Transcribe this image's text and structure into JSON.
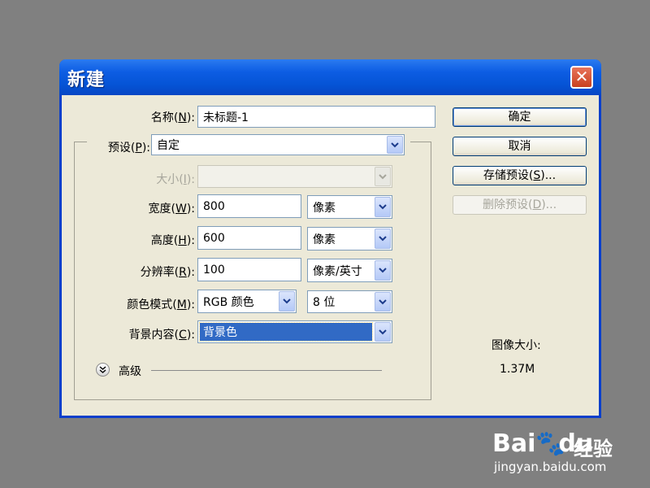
{
  "dialog": {
    "title": "新建",
    "close_glyph": "✕"
  },
  "form": {
    "name_label": "名称(",
    "name_key": "N",
    "name_end": "):",
    "name_value": "未标题-1",
    "preset_label": "预设(",
    "preset_key": "P",
    "preset_end": "):",
    "preset_value": "自定",
    "size_label": "大小(",
    "size_key": "I",
    "size_end": "):",
    "size_value": "",
    "width_label": "宽度(",
    "width_key": "W",
    "width_end": "):",
    "width_value": "800",
    "width_unit": "像素",
    "height_label": "高度(",
    "height_key": "H",
    "height_end": "):",
    "height_value": "600",
    "height_unit": "像素",
    "resolution_label": "分辨率(",
    "resolution_key": "R",
    "resolution_end": "):",
    "resolution_value": "100",
    "resolution_unit": "像素/英寸",
    "mode_label": "颜色模式(",
    "mode_key": "M",
    "mode_end": "):",
    "mode_value": "RGB 颜色",
    "bits_value": "8 位",
    "background_label": "背景内容(",
    "background_key": "C",
    "background_end": "):",
    "background_value": "背景色",
    "advanced_label": "高级",
    "advanced_icon": "chevron-double-down"
  },
  "buttons": {
    "ok": "确定",
    "cancel": "取消",
    "save_preset": "存储预设(",
    "save_key": "S",
    "save_end": ")...",
    "delete_preset": "删除预设(",
    "delete_key": "D",
    "delete_end": ")..."
  },
  "image_size": {
    "label": "图像大小:",
    "value": "1.37M"
  },
  "watermark": {
    "brand_left": "Bai",
    "brand_right": "du",
    "brand_cn": "经验",
    "url": "jingyan.baidu.com"
  },
  "colors": {
    "titlebar": "#0554d6",
    "dialog_bg": "#ece9d8",
    "selection": "#316ac5",
    "desktop": "#808080"
  }
}
